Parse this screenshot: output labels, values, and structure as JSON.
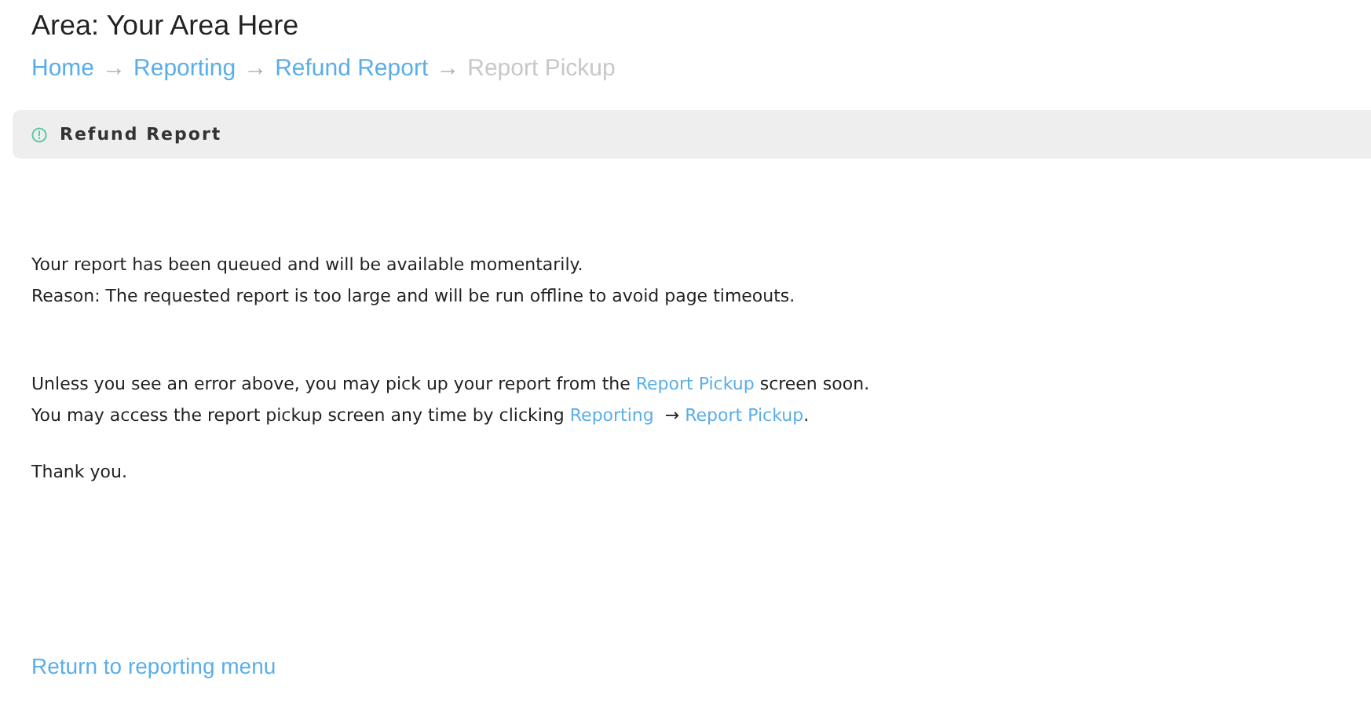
{
  "area_title": "Area: Your Area Here",
  "breadcrumb": {
    "separator": "→",
    "items": [
      {
        "label": "Home",
        "current": false
      },
      {
        "label": "Reporting",
        "current": false
      },
      {
        "label": "Refund Report",
        "current": false
      },
      {
        "label": "Report Pickup",
        "current": true
      }
    ]
  },
  "panel": {
    "title": "Refund Report"
  },
  "paragraphs": [
    {
      "lines": [
        [
          {
            "text": "Your report has been queued and will be available momentarily.",
            "link": false
          }
        ],
        [
          {
            "text": "Reason: The requested report is too large and will be run offline to avoid page timeouts.",
            "link": false
          }
        ]
      ]
    },
    {
      "lines": [
        [
          {
            "text": "Unless you see an error above, you may pick up your report from the ",
            "link": false
          },
          {
            "text": "Report Pickup",
            "link": true
          },
          {
            "text": " screen soon.",
            "link": false
          }
        ],
        [
          {
            "text": "You may access the report pickup screen any time by clicking ",
            "link": false
          },
          {
            "text": "Reporting",
            "link": true
          },
          {
            "text": "  → ",
            "link": false
          },
          {
            "text": "Report Pickup",
            "link": true
          },
          {
            "text": ".",
            "link": false
          }
        ]
      ]
    },
    {
      "lines": [
        [
          {
            "text": "Thank you.",
            "link": false
          }
        ]
      ]
    }
  ],
  "return_link": "Return to reporting menu"
}
